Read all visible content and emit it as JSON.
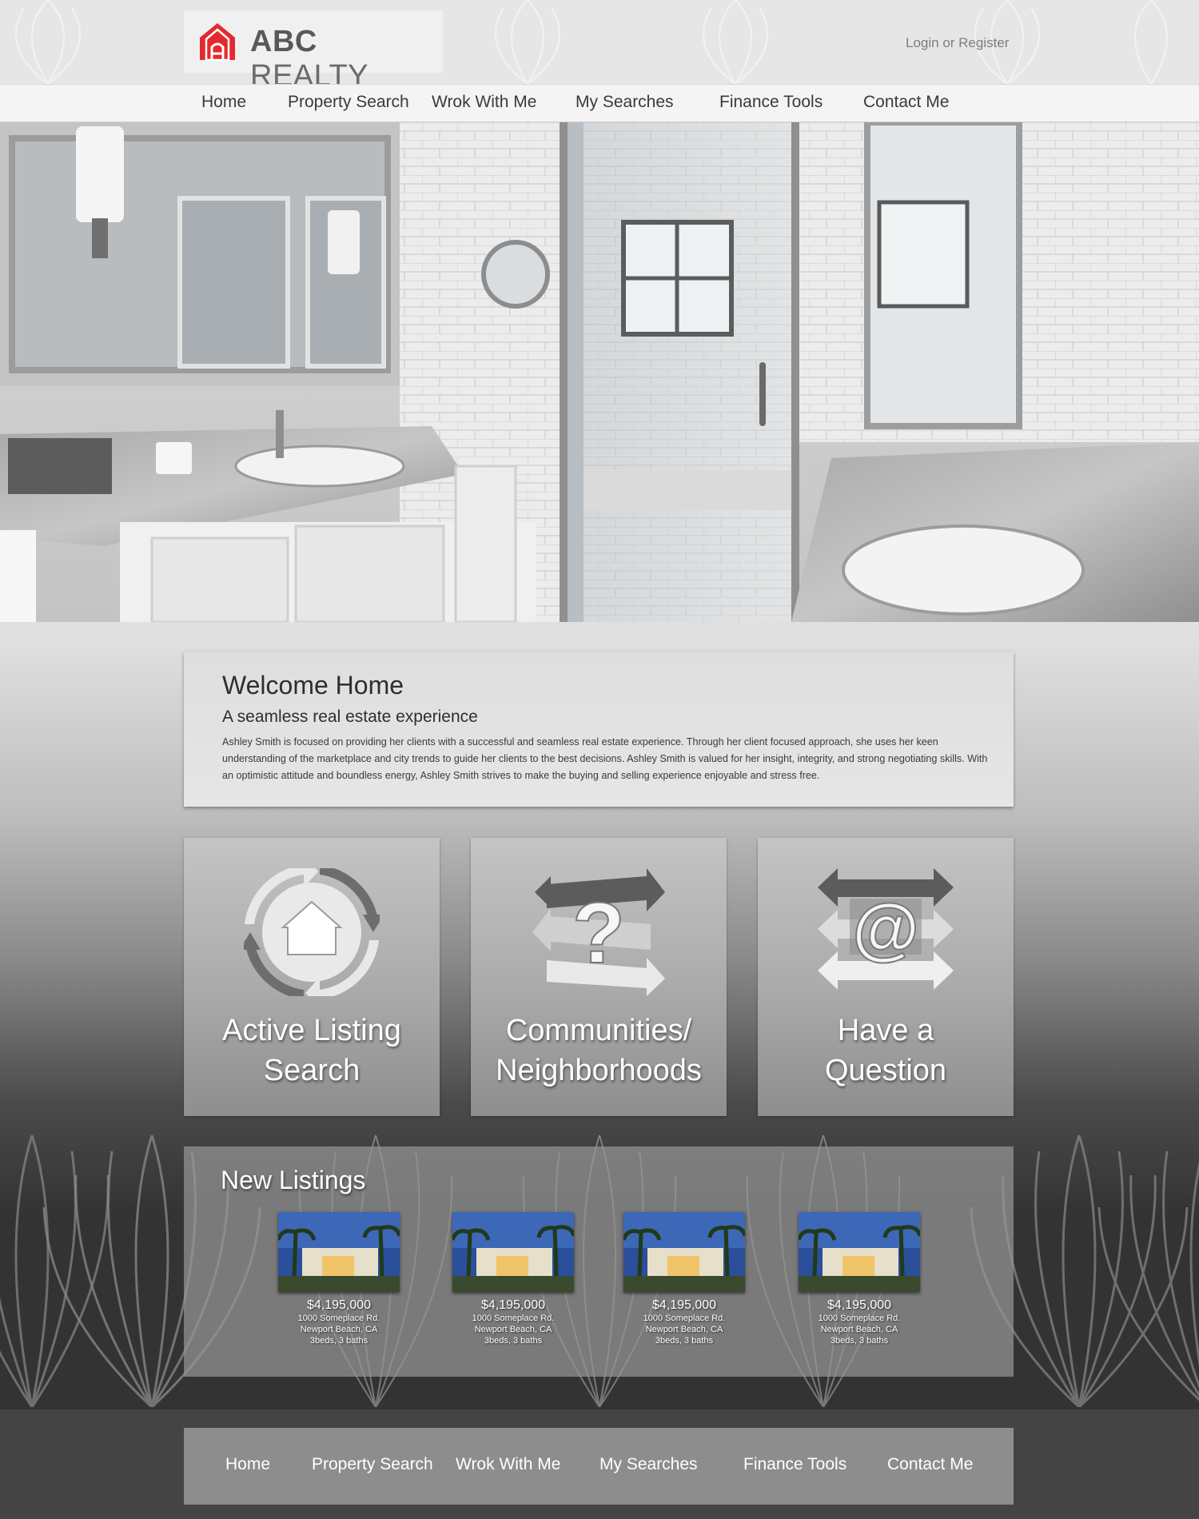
{
  "header": {
    "logo_bold": "ABC",
    "logo_light": " REALTY",
    "login_label": "Login or Register"
  },
  "nav": {
    "items": [
      "Home",
      "Property Search",
      "Wrok With Me",
      "My Searches",
      "Finance Tools",
      "Contact Me"
    ]
  },
  "welcome": {
    "title": "Welcome Home",
    "subtitle": "A seamless real estate experience",
    "body": "Ashley Smith is focused on providing her clients with a successful and seamless real estate experience. Through her client focused approach, she uses her keen understanding of the marketplace and city trends to guide her clients to the best decisions. Ashley Smith is valued for her insight, integrity, and strong negotiating skills. With an optimistic attitude and boundless energy, Ashley Smith strives to make the buying and selling experience enjoyable and stress free."
  },
  "features": [
    {
      "line1": "Active Listing",
      "line2": "Search",
      "icon": "house-cycle-icon"
    },
    {
      "line1": "Communities/",
      "line2": "Neighborhoods",
      "icon": "question-arrows-icon"
    },
    {
      "line1": "Have a",
      "line2": "Question",
      "icon": "at-arrows-icon"
    }
  ],
  "listings": {
    "title": "New Listings",
    "items": [
      {
        "price": "$4,195,000",
        "address": "1000 Someplace Rd.",
        "city": "Newport Beach, CA",
        "details": "3beds, 3 baths"
      },
      {
        "price": "$4,195,000",
        "address": "1000 Someplace Rd.",
        "city": "Newport Beach, CA",
        "details": "3beds, 3 baths"
      },
      {
        "price": "$4,195,000",
        "address": "1000 Someplace Rd.",
        "city": "Newport Beach, CA",
        "details": "3beds, 3 baths"
      },
      {
        "price": "$4,195,000",
        "address": "1000 Someplace Rd.",
        "city": "Newport Beach, CA",
        "details": "3beds, 3 baths"
      }
    ]
  },
  "footer": {
    "items": [
      "Home",
      "Property Search",
      "Wrok With Me",
      "My Searches",
      "Finance Tools",
      "Contact Me"
    ]
  },
  "colors": {
    "brand_red": "#e4282f",
    "logo_gray": "#595959"
  }
}
